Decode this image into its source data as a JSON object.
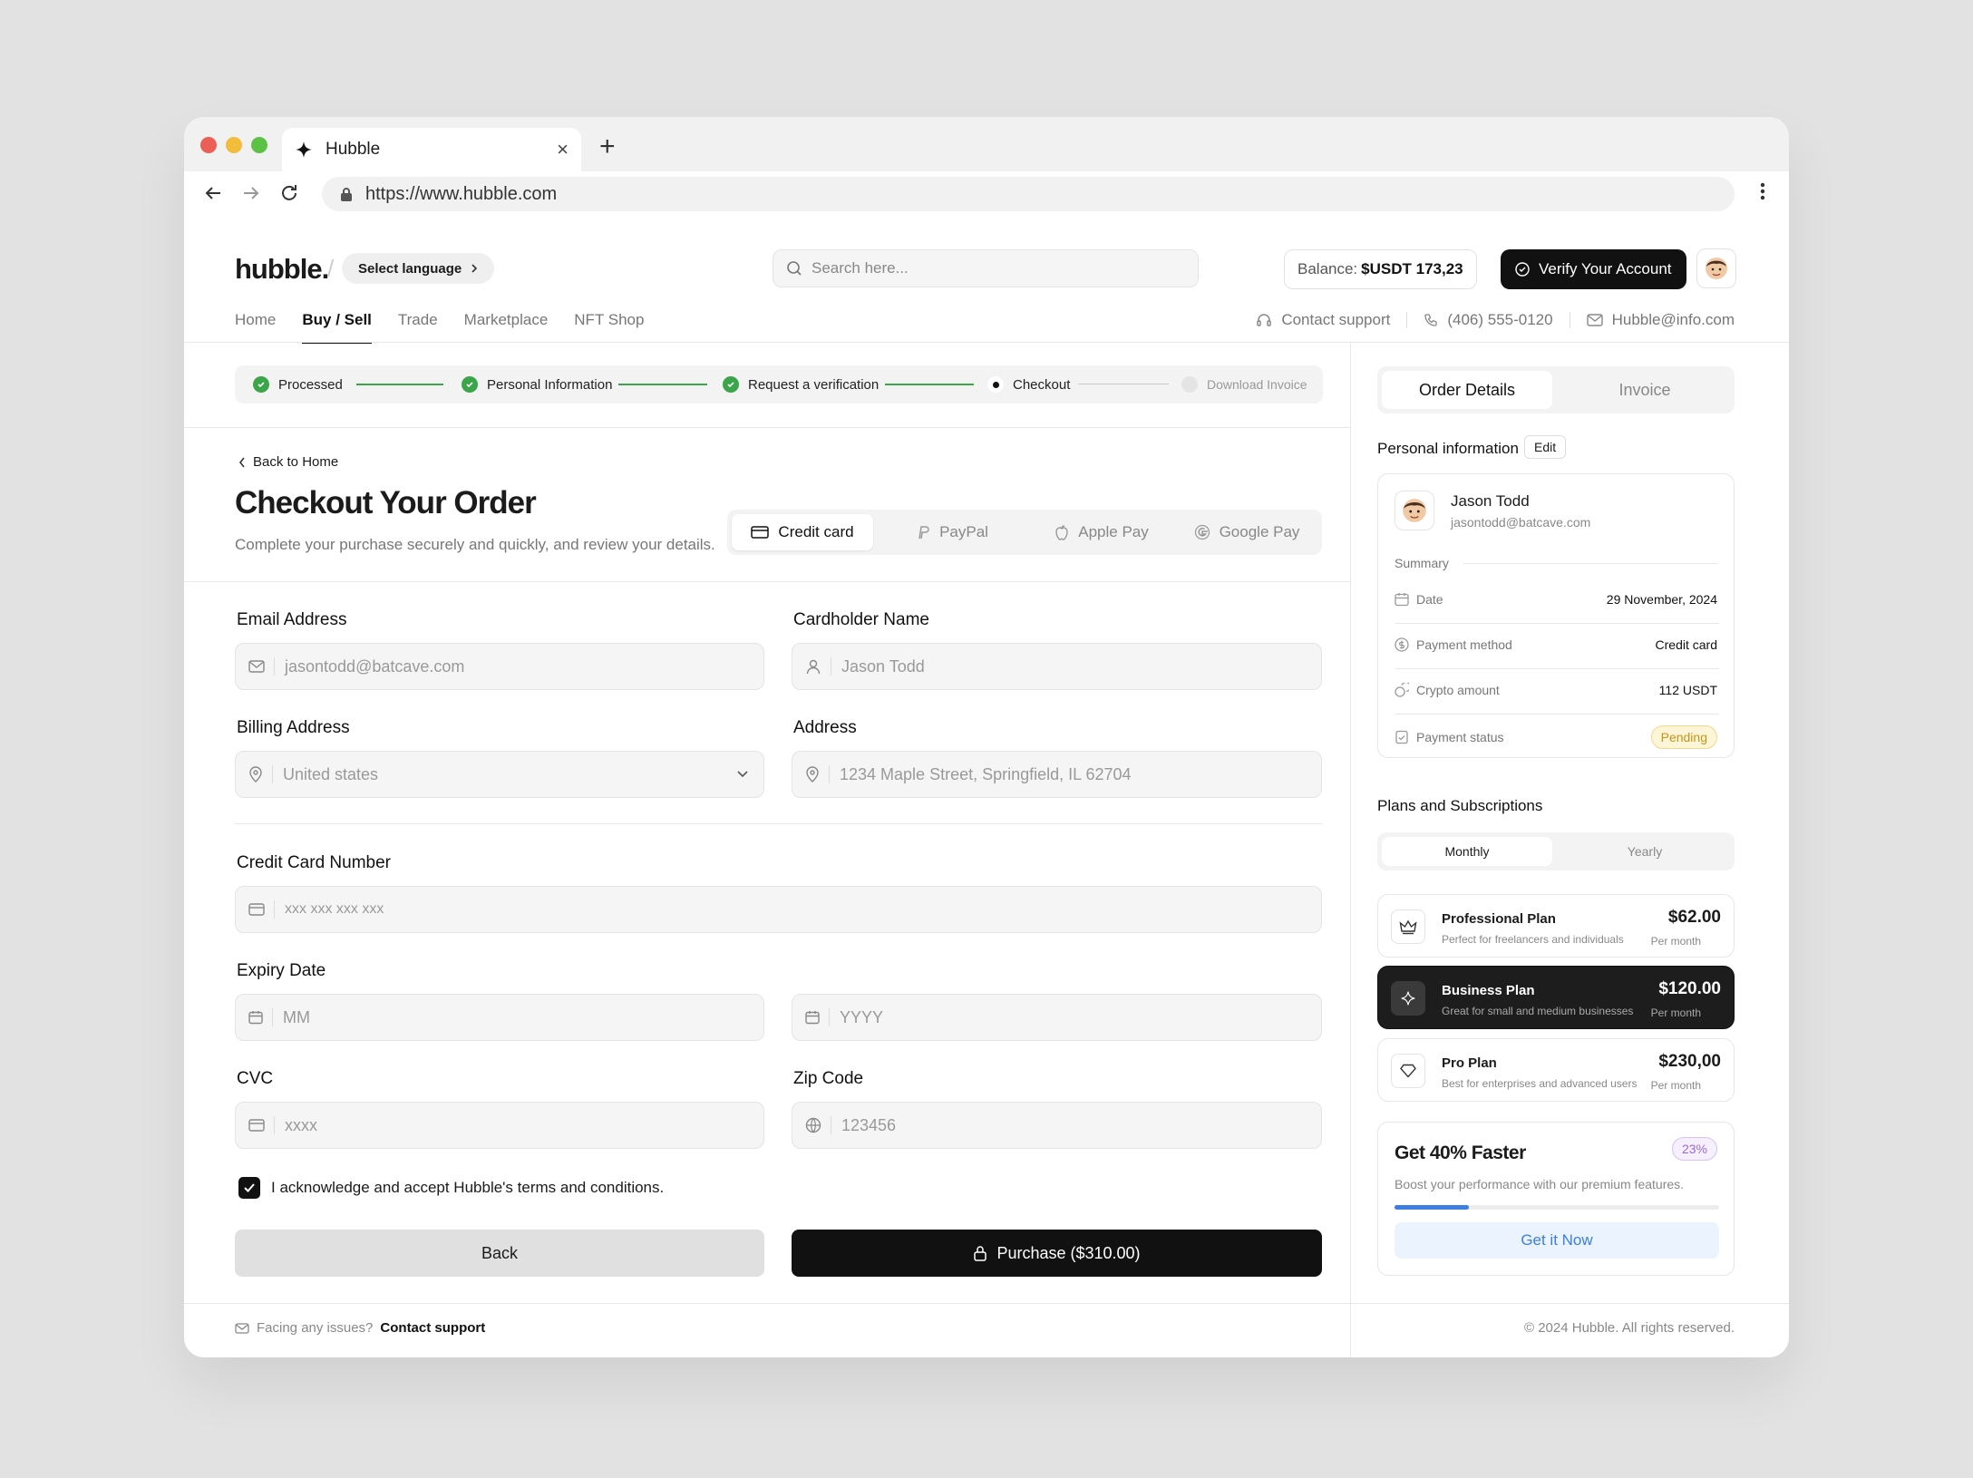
{
  "browser": {
    "tab_title": "Hubble",
    "url": "https://www.hubble.com"
  },
  "header": {
    "logo": "hubble",
    "select_language": "Select language",
    "search_placeholder": "Search here...",
    "balance_label": "Balance:",
    "balance_value": "$USDT 173,23",
    "verify_label": "Verify Your Account",
    "nav": [
      "Home",
      "Buy / Sell",
      "Trade",
      "Marketplace",
      "NFT Shop"
    ],
    "contact_support": "Contact support",
    "phone": "(406) 555-0120",
    "email": "Hubble@info.com"
  },
  "steps": [
    {
      "label": "Processed",
      "state": "done"
    },
    {
      "label": "Personal Information",
      "state": "done"
    },
    {
      "label": "Request a verification",
      "state": "done"
    },
    {
      "label": "Checkout",
      "state": "current"
    },
    {
      "label": "Download Invoice",
      "state": "pending"
    }
  ],
  "checkout": {
    "back_home": "Back to Home",
    "title": "Checkout Your Order",
    "subtitle": "Complete your purchase securely and quickly, and review your details.",
    "payment_tabs": [
      "Credit card",
      "PayPal",
      "Apple Pay",
      "Google Pay"
    ],
    "fields": {
      "email_label": "Email Address",
      "email_value": "jasontodd@batcave.com",
      "cardholder_label": "Cardholder Name",
      "cardholder_value": "Jason Todd",
      "billing_label": "Billing Address",
      "billing_value": "United states",
      "address_label": "Address",
      "address_value": "1234 Maple Street, Springfield, IL 62704",
      "card_label": "Credit Card Number",
      "card_placeholder": "xxx xxx xxx xxx",
      "expiry_label": "Expiry Date",
      "expiry_mm": "MM",
      "expiry_yyyy": "YYYY",
      "cvc_label": "CVC",
      "cvc_placeholder": "xxxx",
      "zip_label": "Zip Code",
      "zip_placeholder": "123456"
    },
    "terms": "I acknowledge and accept Hubble's terms and conditions.",
    "back_button": "Back",
    "purchase_button": "Purchase ($310.00)"
  },
  "footer": {
    "issues": "Facing any issues?",
    "contact": "Contact support",
    "copyright": "© 2024 Hubble. All rights reserved."
  },
  "sidebar": {
    "tabs": [
      "Order Details",
      "Invoice"
    ],
    "personal_info": "Personal information",
    "edit": "Edit",
    "user_name": "Jason Todd",
    "user_email": "jasontodd@batcave.com",
    "summary_label": "Summary",
    "summary": [
      {
        "label": "Date",
        "value": "29 November, 2024"
      },
      {
        "label": "Payment method",
        "value": "Credit card"
      },
      {
        "label": "Crypto amount",
        "value": "112 USDT"
      },
      {
        "label": "Payment status",
        "value": "Pending"
      }
    ],
    "plans_title": "Plans and Subscriptions",
    "plan_tabs": [
      "Monthly",
      "Yearly"
    ],
    "plans": [
      {
        "name": "Professional Plan",
        "desc": "Perfect for freelancers and individuals",
        "price": "$62.00",
        "period": "Per month"
      },
      {
        "name": "Business Plan",
        "desc": "Great for small and medium businesses",
        "price": "$120.00",
        "period": "Per month"
      },
      {
        "name": "Pro Plan",
        "desc": "Best for enterprises and advanced users",
        "price": "$230,00",
        "period": "Per month"
      }
    ],
    "promo": {
      "title": "Get 40% Faster",
      "badge": "23%",
      "desc": "Boost your performance with our premium features.",
      "progress": 0.23,
      "cta": "Get it Now"
    }
  },
  "colors": {
    "accent_dark": "#111111",
    "success": "#3ba54a",
    "pending": "#c4951a",
    "promo_blue": "#3d7ee0",
    "badge_purple": "#9b6ad6"
  }
}
